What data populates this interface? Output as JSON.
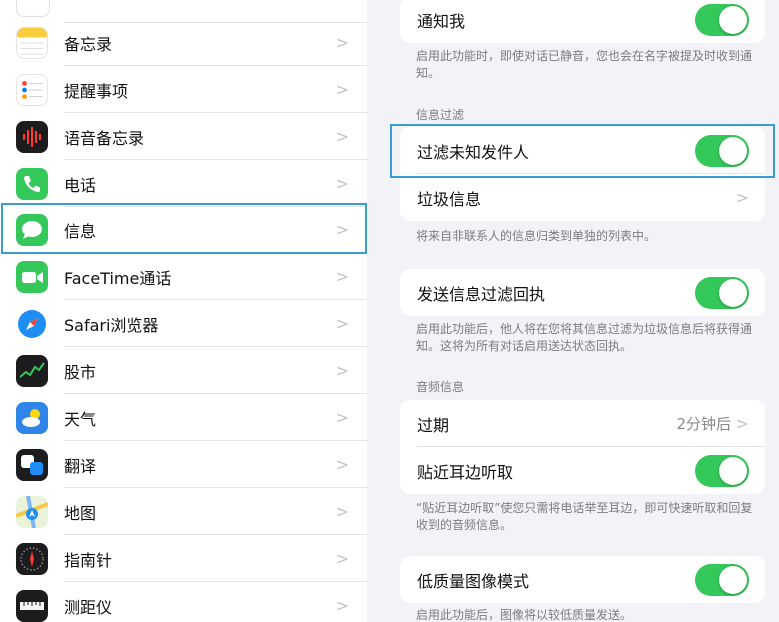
{
  "sidebar": {
    "items": [
      {
        "label": "备忘录",
        "icon": "notes-icon"
      },
      {
        "label": "提醒事项",
        "icon": "reminders-icon"
      },
      {
        "label": "语音备忘录",
        "icon": "voice-memos-icon"
      },
      {
        "label": "电话",
        "icon": "phone-icon"
      },
      {
        "label": "信息",
        "icon": "messages-icon"
      },
      {
        "label": "FaceTime通话",
        "icon": "facetime-icon"
      },
      {
        "label": "Safari浏览器",
        "icon": "safari-icon"
      },
      {
        "label": "股市",
        "icon": "stocks-icon"
      },
      {
        "label": "天气",
        "icon": "weather-icon"
      },
      {
        "label": "翻译",
        "icon": "translate-icon"
      },
      {
        "label": "地图",
        "icon": "maps-icon"
      },
      {
        "label": "指南针",
        "icon": "compass-icon"
      },
      {
        "label": "测距仪",
        "icon": "measure-icon"
      }
    ],
    "chevron": ">"
  },
  "detail": {
    "notify_me": {
      "label": "通知我",
      "on": true
    },
    "notify_me_footnote": "启用此功能时，即使对话已静音，您也会在名字被提及时收到通知。",
    "message_filtering_header": "信息过滤",
    "filter_unknown": {
      "label": "过滤未知发件人",
      "on": true
    },
    "junk": {
      "label": "垃圾信息"
    },
    "junk_footnote": "将来自非联系人的信息归类到单独的列表中。",
    "send_filter_receipts": {
      "label": "发送信息过滤回执",
      "on": true
    },
    "send_filter_footnote": "启用此功能后，他人将在您将其信息过滤为垃圾信息后将获得通知。这将为所有对话启用送达状态回执。",
    "audio_header": "音频信息",
    "expire": {
      "label": "过期",
      "value": "2分钟后"
    },
    "raise_to_listen": {
      "label": "贴近耳边听取",
      "on": true
    },
    "raise_footnote": "“贴近耳边听取”使您只需将电话举至耳边，即可快速听取和回复收到的音频信息。",
    "low_quality": {
      "label": "低质量图像模式",
      "on": true
    },
    "low_quality_footnote": "启用此功能后，图像将以较低质量发送。",
    "chevron": ">"
  },
  "colors": {
    "toggle_on": "#34c759",
    "highlight": "#3b9bd5"
  }
}
